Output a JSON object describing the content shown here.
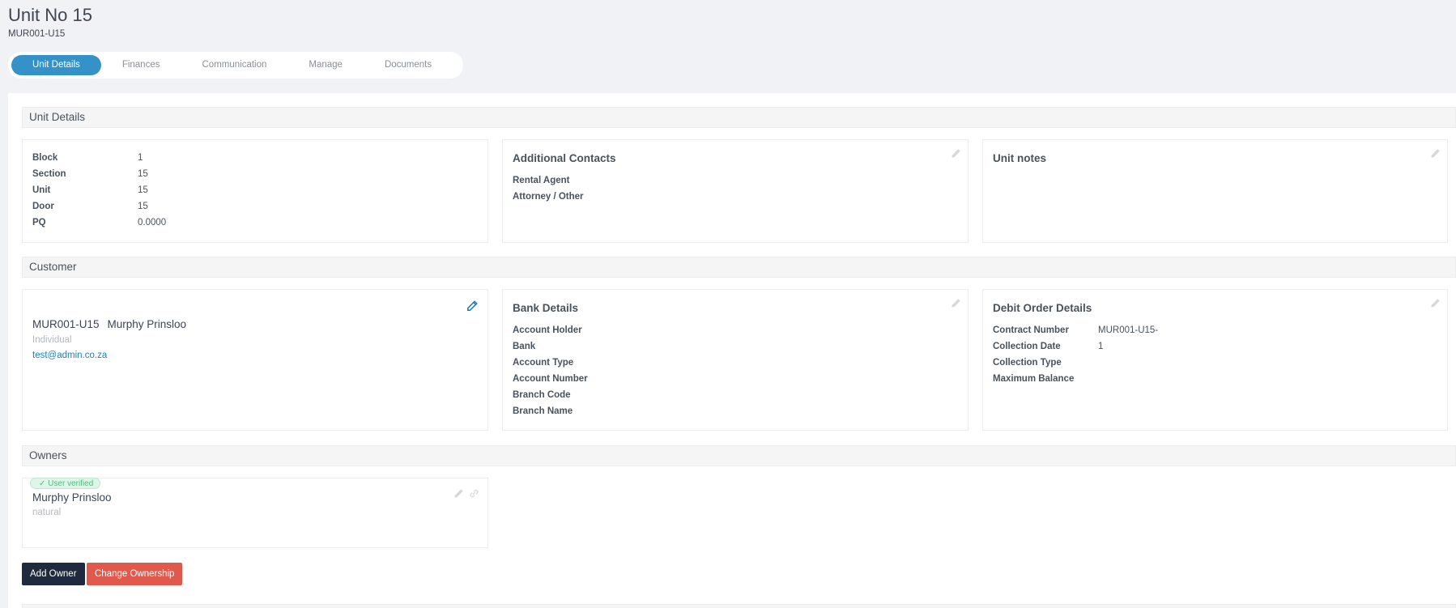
{
  "header": {
    "title": "Unit No 15",
    "subtitle": "MUR001-U15"
  },
  "tabs": [
    {
      "label": "Unit Details",
      "active": true
    },
    {
      "label": "Finances"
    },
    {
      "label": "Communication"
    },
    {
      "label": "Manage"
    },
    {
      "label": "Documents"
    }
  ],
  "unit_section": {
    "title": "Unit Details",
    "details": [
      {
        "key": "Block",
        "value": "1"
      },
      {
        "key": "Section",
        "value": "15"
      },
      {
        "key": "Unit",
        "value": "15"
      },
      {
        "key": "Door",
        "value": "15"
      },
      {
        "key": "PQ",
        "value": "0.0000"
      }
    ],
    "contacts": {
      "title": "Additional Contacts",
      "items": [
        "Rental Agent",
        "Attorney / Other"
      ]
    },
    "notes": {
      "title": "Unit notes"
    }
  },
  "customer_section": {
    "title": "Customer",
    "customer": {
      "code": "MUR001-U15",
      "name": "Murphy Prinsloo",
      "type": "Individual",
      "email": "test@admin.co.za"
    },
    "bank": {
      "title": "Bank Details",
      "items": [
        "Account Holder",
        "Bank",
        "Account Type",
        "Account Number",
        "Branch Code",
        "Branch Name"
      ]
    },
    "debit": {
      "title": "Debit Order Details",
      "items": [
        {
          "key": "Contract Number",
          "value": "MUR001-U15-"
        },
        {
          "key": "Collection Date",
          "value": "1"
        },
        {
          "key": "Collection Type",
          "value": ""
        },
        {
          "key": "Maximum Balance",
          "value": ""
        }
      ]
    }
  },
  "owners_section": {
    "title": "Owners",
    "badge": "User verified",
    "owner": {
      "name": "Murphy Prinsloo",
      "type": "natural"
    },
    "add_owner_label": "Add Owner",
    "change_ownership_label": "Change Ownership"
  },
  "colors": {
    "accent": "#3592c8",
    "dark_button": "#1f2a3e",
    "red_button": "#e0594c",
    "link": "#1d7eb6",
    "verified": "#4cbf7f"
  }
}
